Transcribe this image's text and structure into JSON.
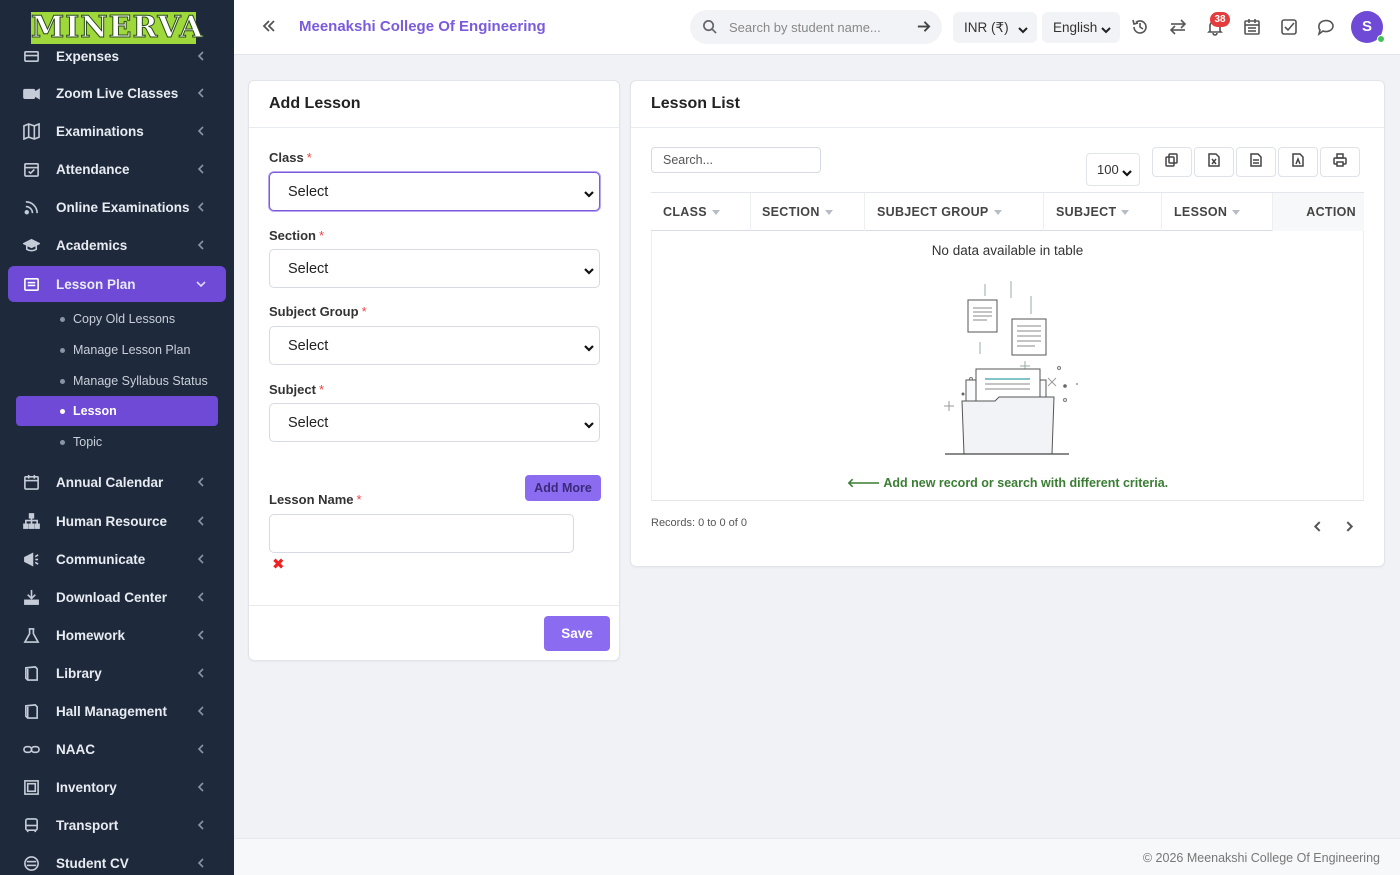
{
  "brand": {
    "logo_text": "MINERVA"
  },
  "sidebar": {
    "items": [
      {
        "label": "Expenses",
        "icon": "expenses-icon"
      },
      {
        "label": "Zoom Live Classes",
        "icon": "video-icon"
      },
      {
        "label": "Examinations",
        "icon": "map-icon"
      },
      {
        "label": "Attendance",
        "icon": "calendar-check-icon"
      },
      {
        "label": "Online Examinations",
        "icon": "rss-icon"
      },
      {
        "label": "Academics",
        "icon": "graduation-cap-icon"
      },
      {
        "label": "Lesson Plan",
        "icon": "list-icon",
        "active": true
      },
      {
        "label": "Annual Calendar",
        "icon": "calendar-icon"
      },
      {
        "label": "Human Resource",
        "icon": "sitemap-icon"
      },
      {
        "label": "Communicate",
        "icon": "bullhorn-icon"
      },
      {
        "label": "Download Center",
        "icon": "download-icon"
      },
      {
        "label": "Homework",
        "icon": "flask-icon"
      },
      {
        "label": "Library",
        "icon": "book-icon"
      },
      {
        "label": "Hall Management",
        "icon": "book-icon"
      },
      {
        "label": "NAAC",
        "icon": "link-icon"
      },
      {
        "label": "Inventory",
        "icon": "inventory-icon"
      },
      {
        "label": "Transport",
        "icon": "bus-icon"
      },
      {
        "label": "Student CV",
        "icon": "cv-icon"
      }
    ],
    "lesson_plan_sub": [
      {
        "label": "Copy Old Lessons"
      },
      {
        "label": "Manage Lesson Plan"
      },
      {
        "label": "Manage Syllabus Status"
      },
      {
        "label": "Lesson",
        "active": true
      },
      {
        "label": "Topic"
      }
    ]
  },
  "header": {
    "college_name": "Meenakshi College Of Engineering",
    "search_placeholder": "Search by student name...",
    "currency": "INR (₹)",
    "language": "English",
    "notification_count": "38",
    "avatar_initial": "S"
  },
  "add_lesson": {
    "title": "Add Lesson",
    "fields": {
      "class": {
        "label": "Class",
        "value": "Select"
      },
      "section": {
        "label": "Section",
        "value": "Select"
      },
      "subject_group": {
        "label": "Subject Group",
        "value": "Select"
      },
      "subject": {
        "label": "Subject",
        "value": "Select"
      },
      "lesson_name": {
        "label": "Lesson Name",
        "value": ""
      }
    },
    "required_mark": "*",
    "add_more_label": "Add More",
    "remove_mark": "✖",
    "save_label": "Save"
  },
  "lesson_list": {
    "title": "Lesson List",
    "search_placeholder": "Search...",
    "page_length": "100",
    "columns": [
      "CLASS",
      "SECTION",
      "SUBJECT GROUP",
      "SUBJECT",
      "LESSON",
      "ACTION"
    ],
    "empty_text": "No data available in table",
    "empty_hint": "Add new record or search with different criteria.",
    "records_text": "Records: 0 to 0 of 0"
  },
  "footer": {
    "copyright": "© 2026 Meenakshi College Of Engineering"
  },
  "colors": {
    "sidebar_bg": "#1e2a3b",
    "accent": "#6e4ad6",
    "button": "#8b6cf0",
    "logo_bg": "#9fd83a",
    "hint_green": "#3a7d33"
  }
}
